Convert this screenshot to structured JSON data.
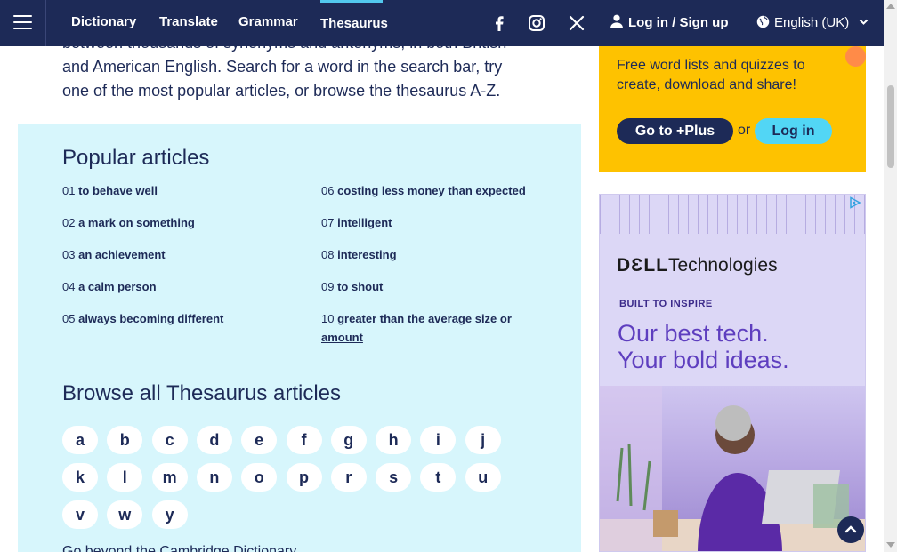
{
  "nav": {
    "links": [
      "Dictionary",
      "Translate",
      "Grammar",
      "Thesaurus"
    ],
    "login_label": "Log in / Sign up",
    "language": "English (UK)"
  },
  "intro": {
    "line1": "between thousands of synonyms and antonyms, in both British",
    "line2": "and American English. Search for a word in the search bar, try",
    "line3": "one of the most popular articles, or browse the thesaurus A-Z."
  },
  "popular": {
    "heading": "Popular articles",
    "items": [
      {
        "num": "01",
        "text": "to behave well"
      },
      {
        "num": "02",
        "text": "a mark on something"
      },
      {
        "num": "03",
        "text": "an achievement"
      },
      {
        "num": "04",
        "text": "a calm person"
      },
      {
        "num": "05",
        "text": "always becoming different"
      },
      {
        "num": "06",
        "text": "costing less money than expected"
      },
      {
        "num": "07",
        "text": "intelligent"
      },
      {
        "num": "08",
        "text": "interesting"
      },
      {
        "num": "09",
        "text": "to shout"
      },
      {
        "num": "10",
        "text": "greater than the average size or amount"
      }
    ]
  },
  "browse": {
    "heading": "Browse all Thesaurus articles",
    "letters": [
      "a",
      "b",
      "c",
      "d",
      "e",
      "f",
      "g",
      "h",
      "i",
      "j",
      "k",
      "l",
      "m",
      "n",
      "o",
      "p",
      "r",
      "s",
      "t",
      "u",
      "v",
      "w",
      "y"
    ],
    "footer_partial": "Go beyond the Cambridge Dictionary..."
  },
  "plus": {
    "text": "Free word lists and quizzes to create, download and share!",
    "go_label": "Go to +Plus",
    "or": "or",
    "login_label": "Log in"
  },
  "ad": {
    "brand_bold": "DƐLL",
    "brand_rest": "Technologies",
    "built": "BUILT TO INSPIRE",
    "line1": "Our best tech.",
    "line2": "Your bold ideas."
  },
  "colors": {
    "navy": "#1d2a57",
    "panel": "#d7f6fc",
    "plus_yellow": "#fec200",
    "accent_cyan": "#52d6f5"
  }
}
